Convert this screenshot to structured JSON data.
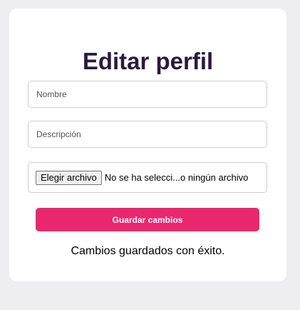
{
  "form": {
    "title": "Editar perfil",
    "name_placeholder": "Nombre",
    "description_placeholder": "Descripción",
    "file_button_label": "Elegir archivo",
    "file_status": "No se ha selecci...o ningún archivo",
    "save_label": "Guardar cambios",
    "status_message": "Cambios guardados con éxito."
  },
  "colors": {
    "background": "#eeeef0",
    "card": "#ffffff",
    "title": "#2b1a3d",
    "accent": "#ea276e"
  }
}
